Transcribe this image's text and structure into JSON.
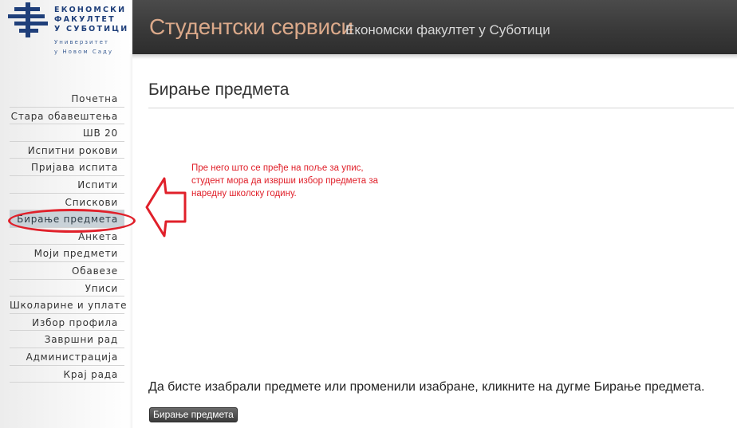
{
  "logo": {
    "line1": "ЕКОНОМСКИ",
    "line2": "ФАКУЛТЕТ",
    "line3": "У СУБОТИЦИ",
    "line4": "Универзитет",
    "line5": "у Новом Саду",
    "color": "#1f3f7a"
  },
  "header": {
    "title": "Студентски сервиси",
    "subtitle": "Економски факултет у Суботици",
    "title_color": "#dba98a"
  },
  "sidebar": {
    "items": [
      {
        "label": "Почетна"
      },
      {
        "label": "Стара обавештења"
      },
      {
        "label": "ШВ 20"
      },
      {
        "label": "Испитни рокови"
      },
      {
        "label": "Пријава испита"
      },
      {
        "label": "Испити"
      },
      {
        "label": "Спискови"
      },
      {
        "label": "Бирање предмета",
        "active": true
      },
      {
        "label": "Анкета"
      },
      {
        "label": "Моји предмети"
      },
      {
        "label": "Обавезе"
      },
      {
        "label": "Уписи"
      },
      {
        "label": "Школарине и уплате"
      },
      {
        "label": "Избор профила"
      },
      {
        "label": "Завршни рад"
      },
      {
        "label": "Администрација"
      },
      {
        "label": "Крај рада"
      }
    ]
  },
  "main": {
    "page_title": "Бирање предмета",
    "annotation": "Пре него што се пређе на поље за упис, студент мора да изврши избор предмета за наредну школску годину.",
    "instruction": "Да бисте изабрали предмете или променили изабране, кликните на дугме Бирање предмета.",
    "button_label": "Бирање предмета"
  },
  "annotation_color": "#e0202a"
}
